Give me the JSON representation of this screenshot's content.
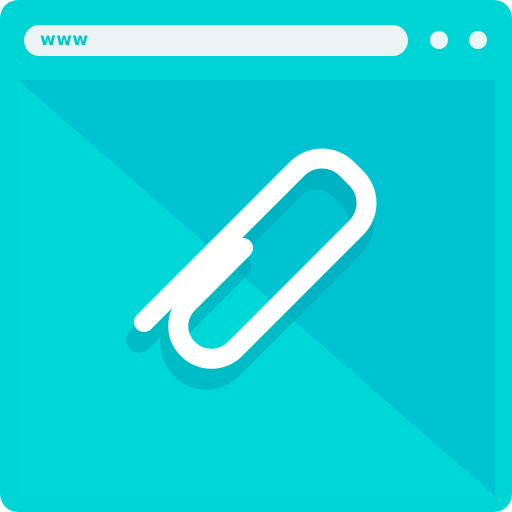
{
  "browser": {
    "address_bar": {
      "value": "www"
    },
    "window_controls": [
      {
        "icon": "dot-icon"
      },
      {
        "icon": "dot-icon"
      }
    ]
  },
  "content": {
    "icon": "paperclip-icon"
  },
  "colors": {
    "frame": "#00d4d4",
    "content_light": "#00d8d8",
    "content_shadow": "#00c3d2",
    "bar": "#ebf3f4",
    "accent_text": "#00c9c9",
    "icon": "#ffffff",
    "icon_shadow": "#00b0be"
  }
}
